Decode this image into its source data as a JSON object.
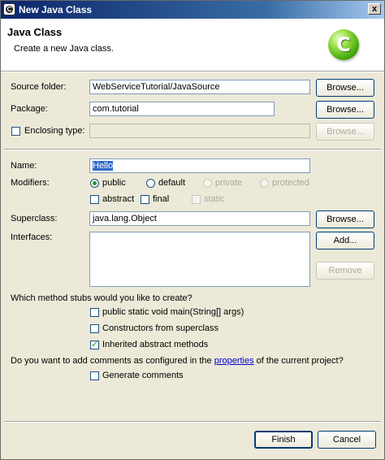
{
  "window": {
    "title": "New Java Class",
    "close_glyph": "x"
  },
  "header": {
    "title": "Java Class",
    "subtitle": "Create a new Java class.",
    "logo_letter": "C"
  },
  "form": {
    "source_folder": {
      "label": "Source folder:",
      "value": "WebServiceTutorial/JavaSource",
      "button": "Browse..."
    },
    "package": {
      "label": "Package:",
      "value": "com.tutorial",
      "button": "Browse..."
    },
    "enclosing_type": {
      "label": "Enclosing type:",
      "value": "",
      "button": "Browse...",
      "checked": false
    },
    "name": {
      "label": "Name:",
      "value": "Hello"
    },
    "modifiers": {
      "label": "Modifiers:",
      "access": [
        {
          "label": "public",
          "selected": true,
          "enabled": true
        },
        {
          "label": "default",
          "selected": false,
          "enabled": true
        },
        {
          "label": "private",
          "selected": false,
          "enabled": false
        },
        {
          "label": "protected",
          "selected": false,
          "enabled": false
        }
      ],
      "flags": [
        {
          "label": "abstract",
          "checked": false,
          "enabled": true
        },
        {
          "label": "final",
          "checked": false,
          "enabled": true
        },
        {
          "label": "static",
          "checked": false,
          "enabled": false
        }
      ]
    },
    "superclass": {
      "label": "Superclass:",
      "value": "java.lang.Object",
      "button": "Browse..."
    },
    "interfaces": {
      "label": "Interfaces:",
      "add_button": "Add...",
      "remove_button": "Remove"
    },
    "stubs": {
      "question": "Which method stubs would you like to create?",
      "options": [
        {
          "label": "public static void main(String[] args)",
          "checked": false
        },
        {
          "label": "Constructors from superclass",
          "checked": false
        },
        {
          "label": "Inherited abstract methods",
          "checked": true
        }
      ]
    },
    "comments": {
      "question_prefix": "Do you want to add comments as configured in the ",
      "question_link": "properties",
      "question_suffix": " of the current project?",
      "option": {
        "label": "Generate comments",
        "checked": false
      }
    }
  },
  "footer": {
    "finish": "Finish",
    "cancel": "Cancel"
  }
}
